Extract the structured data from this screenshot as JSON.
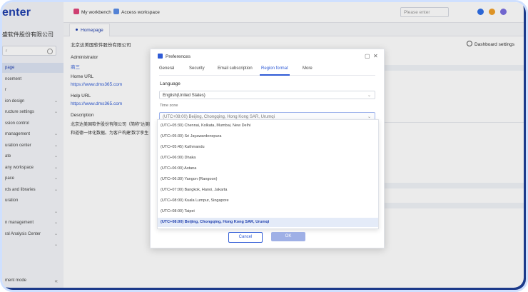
{
  "brand": "enter",
  "sidebar": {
    "company": "盛软件股份有限公司",
    "search_placeholder": "r",
    "items": [
      {
        "label": "page",
        "chevron": false,
        "active": true
      },
      {
        "label": "ncement",
        "chevron": false,
        "active": false
      },
      {
        "label": "r",
        "chevron": false,
        "active": false
      },
      {
        "label": "ion design",
        "chevron": true,
        "active": false
      },
      {
        "label": "ructure settings",
        "chevron": true,
        "active": false
      },
      {
        "label": "ssion control",
        "chevron": false,
        "active": false
      },
      {
        "label": "management",
        "chevron": true,
        "active": false
      },
      {
        "label": "uration center",
        "chevron": true,
        "active": false
      },
      {
        "label": "ate",
        "chevron": true,
        "active": false
      },
      {
        "label": "any workspace",
        "chevron": true,
        "active": false
      },
      {
        "label": "pace",
        "chevron": true,
        "active": false
      },
      {
        "label": "rds and libraries",
        "chevron": true,
        "active": false
      },
      {
        "label": "uration",
        "chevron": false,
        "active": false
      },
      {
        "label": "",
        "chevron": true,
        "active": false
      },
      {
        "label": "n management",
        "chevron": true,
        "active": false
      },
      {
        "label": "ral Analysis Center",
        "chevron": true,
        "active": false
      },
      {
        "label": "",
        "chevron": true,
        "active": false
      }
    ],
    "footer": "ment mode",
    "collapse_icon": "«"
  },
  "topbar": {
    "my_workbench": "My workbench",
    "access_workspace": "Access workspace",
    "search_placeholder": "Please enter"
  },
  "tabs": {
    "home": "Homepage"
  },
  "main": {
    "title": "北京达美国软件股份有限公司",
    "dashboard_settings": "Dashboard settings",
    "administrator_label": "Administrator",
    "administrator_value": "商三",
    "home_url_label": "Home URL",
    "home_url_value": "https://www.dms365.com",
    "help_url_label": "Help URL",
    "help_url_value": "https://www.dms365.com",
    "description_label": "Description",
    "description_line1": "北京达美国软件股份有限公司（简称\"达美国\"）",
    "description_line2": "和道德一体化数据。为客户构建'数字孪生 (Digi"
  },
  "dialog": {
    "title": "Preferences",
    "tabs": [
      "General",
      "Security",
      "Email subscription",
      "Region format",
      "More"
    ],
    "active_tab": "Region format",
    "language_label": "Language",
    "language_value": "English(United States)",
    "timezone_label": "Time zone",
    "timezone_value": "(UTC+08:00) Beijing, Chongqing, Hong Kong SAR, Urumqi",
    "timezone_options": [
      "(UTC+05:30) Chennai, Kolkata, Mumbai, New Delhi",
      "(UTC+05:30) Sri Jayawardenepura",
      "(UTC+05:45) Kathmandu",
      "(UTC+06:00) Dhaka",
      "(UTC+06:00) Astana",
      "(UTC+06:30) Yangon (Rangoon)",
      "(UTC+07:00) Bangkok, Hanoi, Jakarta",
      "(UTC+08:00) Kuala Lumpur, Singapore",
      "(UTC+08:00) Taipei",
      "(UTC+08:00) Beijing, Chongqing, Hong Kong SAR, Urumqi"
    ],
    "selected_option_index": 9,
    "cancel_label": "Cancel",
    "ok_label": "OK"
  },
  "colors": {
    "accent": "#2f5bd6",
    "brand": "#1f3fae",
    "ok_disabled": "#9fb0e6"
  }
}
